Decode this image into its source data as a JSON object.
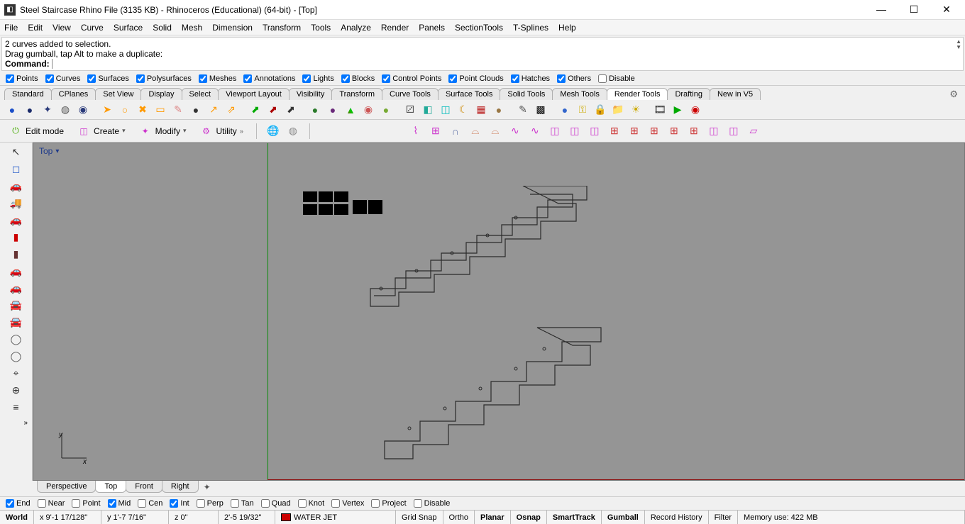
{
  "title": "Steel Staircase Rhino File (3135 KB) - Rhinoceros (Educational) (64-bit) - [Top]",
  "menubar": [
    "File",
    "Edit",
    "View",
    "Curve",
    "Surface",
    "Solid",
    "Mesh",
    "Dimension",
    "Transform",
    "Tools",
    "Analyze",
    "Render",
    "Panels",
    "SectionTools",
    "T-Splines",
    "Help"
  ],
  "command_history": [
    "2 curves added to selection.",
    "Drag gumball, tap Alt to make a duplicate:"
  ],
  "command_label": "Command:",
  "filters": [
    {
      "label": "Points",
      "checked": true
    },
    {
      "label": "Curves",
      "checked": true
    },
    {
      "label": "Surfaces",
      "checked": true
    },
    {
      "label": "Polysurfaces",
      "checked": true
    },
    {
      "label": "Meshes",
      "checked": true
    },
    {
      "label": "Annotations",
      "checked": true
    },
    {
      "label": "Lights",
      "checked": true
    },
    {
      "label": "Blocks",
      "checked": true
    },
    {
      "label": "Control Points",
      "checked": true
    },
    {
      "label": "Point Clouds",
      "checked": true
    },
    {
      "label": "Hatches",
      "checked": true
    },
    {
      "label": "Others",
      "checked": true
    },
    {
      "label": "Disable",
      "checked": false
    }
  ],
  "tool_tabs": [
    "Standard",
    "CPlanes",
    "Set View",
    "Display",
    "Select",
    "Viewport Layout",
    "Visibility",
    "Transform",
    "Curve Tools",
    "Surface Tools",
    "Solid Tools",
    "Mesh Tools",
    "Render Tools",
    "Drafting",
    "New in V5"
  ],
  "tool_tabs_active": "Render Tools",
  "second_toolbar": {
    "edit_mode": "Edit mode",
    "create": "Create",
    "modify": "Modify",
    "utility": "Utility"
  },
  "viewport_label": "Top",
  "view_tabs": [
    "Perspective",
    "Top",
    "Front",
    "Right"
  ],
  "view_tabs_active": "Top",
  "osnaps": [
    {
      "label": "End",
      "checked": true
    },
    {
      "label": "Near",
      "checked": false
    },
    {
      "label": "Point",
      "checked": false
    },
    {
      "label": "Mid",
      "checked": true
    },
    {
      "label": "Cen",
      "checked": false
    },
    {
      "label": "Int",
      "checked": true
    },
    {
      "label": "Perp",
      "checked": false
    },
    {
      "label": "Tan",
      "checked": false
    },
    {
      "label": "Quad",
      "checked": false
    },
    {
      "label": "Knot",
      "checked": false
    },
    {
      "label": "Vertex",
      "checked": false
    },
    {
      "label": "Project",
      "checked": false
    },
    {
      "label": "Disable",
      "checked": false
    }
  ],
  "status": {
    "world": "World",
    "x": "x 9'-1 17/128\"",
    "y": "y 1'-7 7/16\"",
    "z": "z 0\"",
    "dist": "2'-5 19/32\"",
    "layer": "WATER JET",
    "toggles": [
      "Grid Snap",
      "Ortho",
      "Planar",
      "Osnap",
      "SmartTrack",
      "Gumball",
      "Record History",
      "Filter"
    ],
    "toggles_bold": [
      "Planar",
      "Osnap",
      "SmartTrack",
      "Gumball"
    ],
    "memory": "Memory use: 422 MB"
  }
}
